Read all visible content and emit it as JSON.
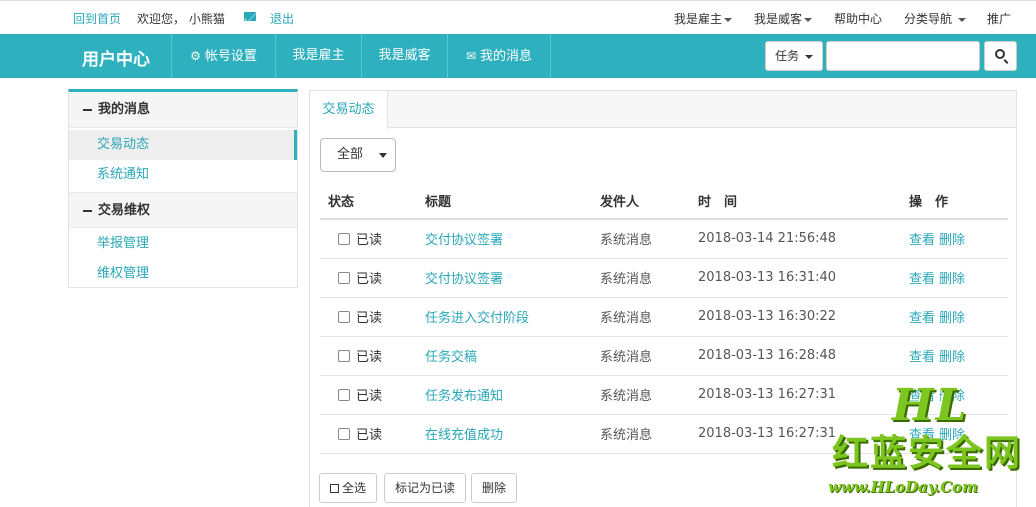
{
  "topbar": {
    "home": "回到首页",
    "welcome": "欢迎您， 小熊猫",
    "logout": "退出",
    "right_links": [
      "我是雇主",
      "我是威客",
      "帮助中心",
      "分类导航",
      "推广"
    ]
  },
  "nav": {
    "brand": "用户中心",
    "items": [
      "帐号设置",
      "我是雇主",
      "我是威客",
      "我的消息"
    ],
    "task_button": "任务"
  },
  "sidebar": {
    "sections": [
      {
        "title": "我的消息",
        "items": [
          "交易动态",
          "系统通知"
        ]
      },
      {
        "title": "交易维权",
        "items": [
          "举报管理",
          "维权管理"
        ]
      }
    ],
    "active": "交易动态"
  },
  "main": {
    "tab": "交易动态",
    "filter": "全部",
    "columns": [
      "状态",
      "标题",
      "发件人",
      "时　间",
      "操　作"
    ],
    "rows": [
      {
        "status": "已读",
        "title": "交付协议签署",
        "sender": "系统消息",
        "time": "2018-03-14 21:56:48",
        "view": "查看",
        "delete": "删除"
      },
      {
        "status": "已读",
        "title": "交付协议签署",
        "sender": "系统消息",
        "time": "2018-03-13 16:31:40",
        "view": "查看",
        "delete": "删除"
      },
      {
        "status": "已读",
        "title": "任务进入交付阶段",
        "sender": "系统消息",
        "time": "2018-03-13 16:30:22",
        "view": "查看",
        "delete": "删除"
      },
      {
        "status": "已读",
        "title": "任务交稿",
        "sender": "系统消息",
        "time": "2018-03-13 16:28:48",
        "view": "查看",
        "delete": "删除"
      },
      {
        "status": "已读",
        "title": "任务发布通知",
        "sender": "系统消息",
        "time": "2018-03-13 16:27:31",
        "view": "查看",
        "delete": "删除"
      },
      {
        "status": "已读",
        "title": "在线充值成功",
        "sender": "系统消息",
        "time": "2018-03-13 16:27:31",
        "view": "查看",
        "delete": "删除"
      }
    ],
    "buttons": {
      "select_all": "全选",
      "mark_read": "标记为已读",
      "delete": "删除"
    }
  },
  "watermark": {
    "logo": "HL",
    "name": "红蓝安全网",
    "url": "www.HLoDay.Com"
  },
  "colors": {
    "accent": "#2eb0bf",
    "link": "#2aa7b8",
    "watermark": "#7dc51f"
  }
}
